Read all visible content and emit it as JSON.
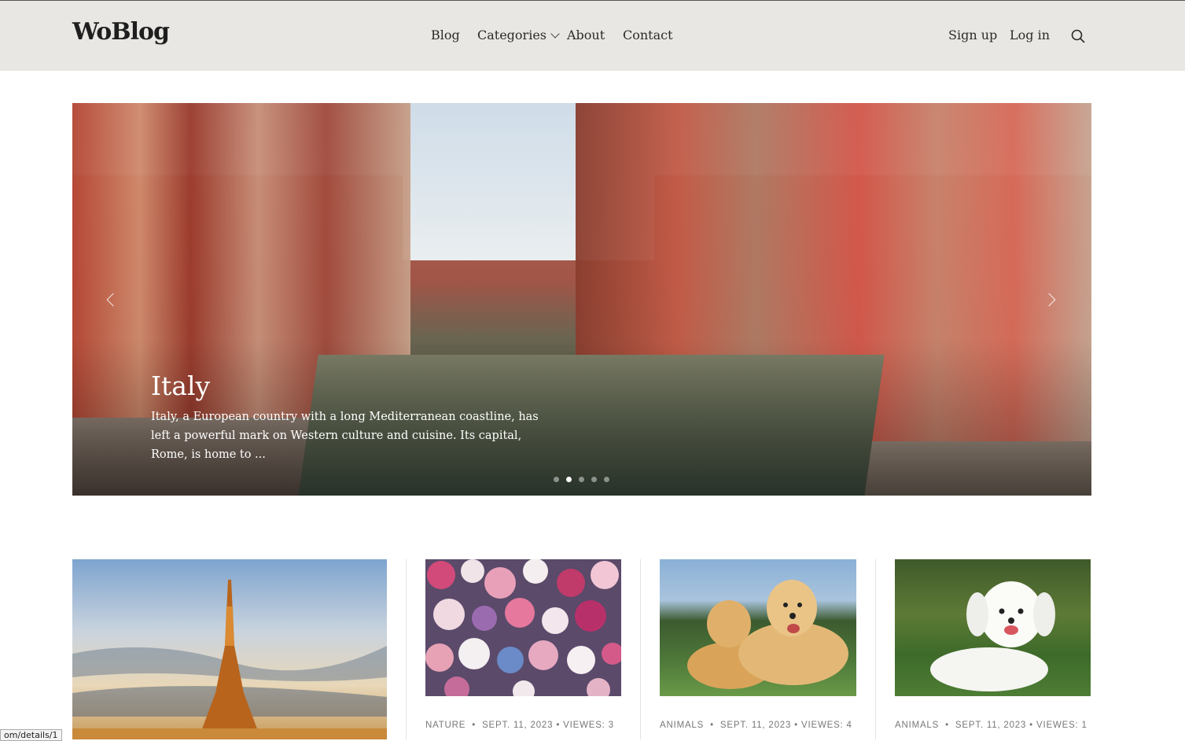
{
  "header": {
    "logo": "WoBlog",
    "nav": [
      "Blog",
      "Categories",
      "About",
      "Contact"
    ],
    "sign_up": "Sign up",
    "log_in": "Log in",
    "search_icon": "search-icon"
  },
  "hero": {
    "title": "Italy",
    "description": "Italy, a European country with a long Mediterranean coastline, has left a powerful mark on Western culture and cuisine. Its capital, Rome, is home to ...",
    "slide_count": 5,
    "active_slide": 2
  },
  "cards": [
    {
      "category": "",
      "date": "",
      "views": ""
    },
    {
      "category": "NATURE",
      "date": "SEPT. 11, 2023",
      "views": "VIEWES: 3"
    },
    {
      "category": "ANIMALS",
      "date": "SEPT. 11, 2023",
      "views": "VIEWES: 4"
    },
    {
      "category": "ANIMALS",
      "date": "SEPT. 11, 2023",
      "views": "VIEWES: 1"
    }
  ],
  "status_bar": {
    "url": "om/details/1"
  },
  "colors": {
    "header_bg": "#e8e7e3",
    "meta_text": "#777777"
  }
}
